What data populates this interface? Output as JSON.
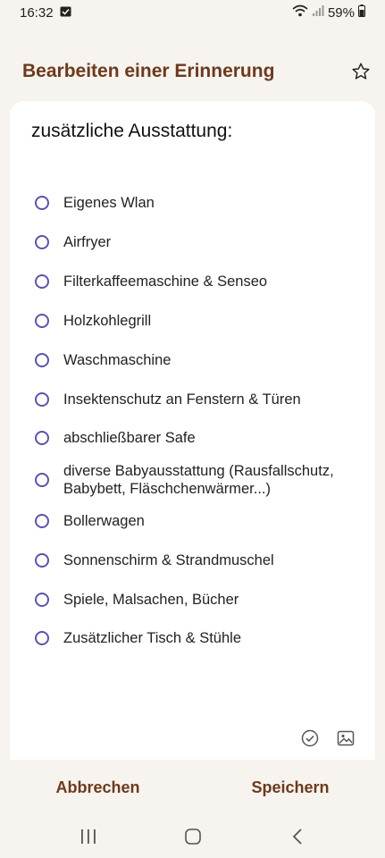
{
  "status": {
    "time": "16:32",
    "battery": "59%"
  },
  "header": {
    "title": "Bearbeiten einer Erinnerung"
  },
  "card": {
    "title": "zusätzliche Ausstattung:",
    "options": [
      {
        "line1": "Eigenes Wlan",
        "line2": ""
      },
      {
        "line1": "Airfryer",
        "line2": ""
      },
      {
        "line1": "Filterkaffeemaschine & Senseo",
        "line2": ""
      },
      {
        "line1": "Holzkohlegrill",
        "line2": ""
      },
      {
        "line1": "Waschmaschine",
        "line2": ""
      },
      {
        "line1": "Insektenschutz an Fenstern & Türen",
        "line2": ""
      },
      {
        "line1": "abschließbarer Safe",
        "line2": ""
      },
      {
        "line1": "diverse Babyausstattung (Rausfallschutz,",
        "line2": "Babybett, Fläschchenwärmer...)"
      },
      {
        "line1": "Bollerwagen",
        "line2": ""
      },
      {
        "line1": "Sonnenschirm & Strandmuschel",
        "line2": ""
      },
      {
        "line1": "Spiele, Malsachen, Bücher",
        "line2": ""
      },
      {
        "line1": "Zusätzlicher Tisch & Stühle",
        "line2": ""
      }
    ]
  },
  "actions": {
    "cancel": "Abbrechen",
    "save": "Speichern"
  },
  "colors": {
    "accent": "#6b3a1e",
    "radio": "#5b54a8",
    "background": "#f7f3ee"
  },
  "icons": [
    "calendar-check-icon",
    "wifi-icon",
    "signal-icon",
    "battery-icon",
    "star-icon",
    "checkbox-circle-icon",
    "image-icon",
    "recents-icon",
    "home-icon",
    "back-icon"
  ]
}
